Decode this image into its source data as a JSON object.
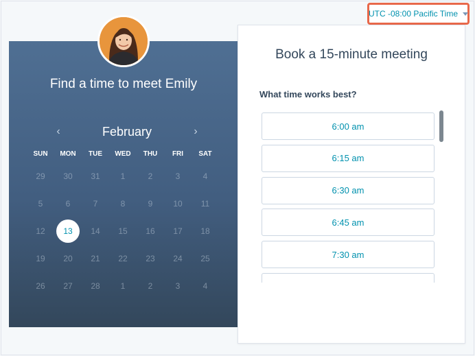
{
  "timezone": {
    "label": "UTC -08:00 Pacific Time",
    "icon": "caret-down-icon"
  },
  "host": {
    "title": "Find a time to meet Emily",
    "avatar": "avatar-photo"
  },
  "calendar": {
    "month": "February",
    "prev_icon": "chevron-left-icon",
    "next_icon": "chevron-right-icon",
    "days_of_week": [
      "SUN",
      "MON",
      "TUE",
      "WED",
      "THU",
      "FRI",
      "SAT"
    ],
    "weeks": [
      [
        "29",
        "30",
        "31",
        "1",
        "2",
        "3",
        "4"
      ],
      [
        "5",
        "6",
        "7",
        "8",
        "9",
        "10",
        "11"
      ],
      [
        "12",
        "13",
        "14",
        "15",
        "16",
        "17",
        "18"
      ],
      [
        "19",
        "20",
        "21",
        "22",
        "23",
        "24",
        "25"
      ],
      [
        "26",
        "27",
        "28",
        "1",
        "2",
        "3",
        "4"
      ]
    ],
    "selected_day": "13"
  },
  "booking": {
    "title": "Book a 15-minute meeting",
    "question": "What time works best?",
    "slots": [
      "6:00 am",
      "6:15 am",
      "6:30 am",
      "6:45 am",
      "7:30 am",
      ""
    ]
  },
  "colors": {
    "accent": "#0091ae",
    "highlight": "#e8684a",
    "panel": "#425e80"
  }
}
